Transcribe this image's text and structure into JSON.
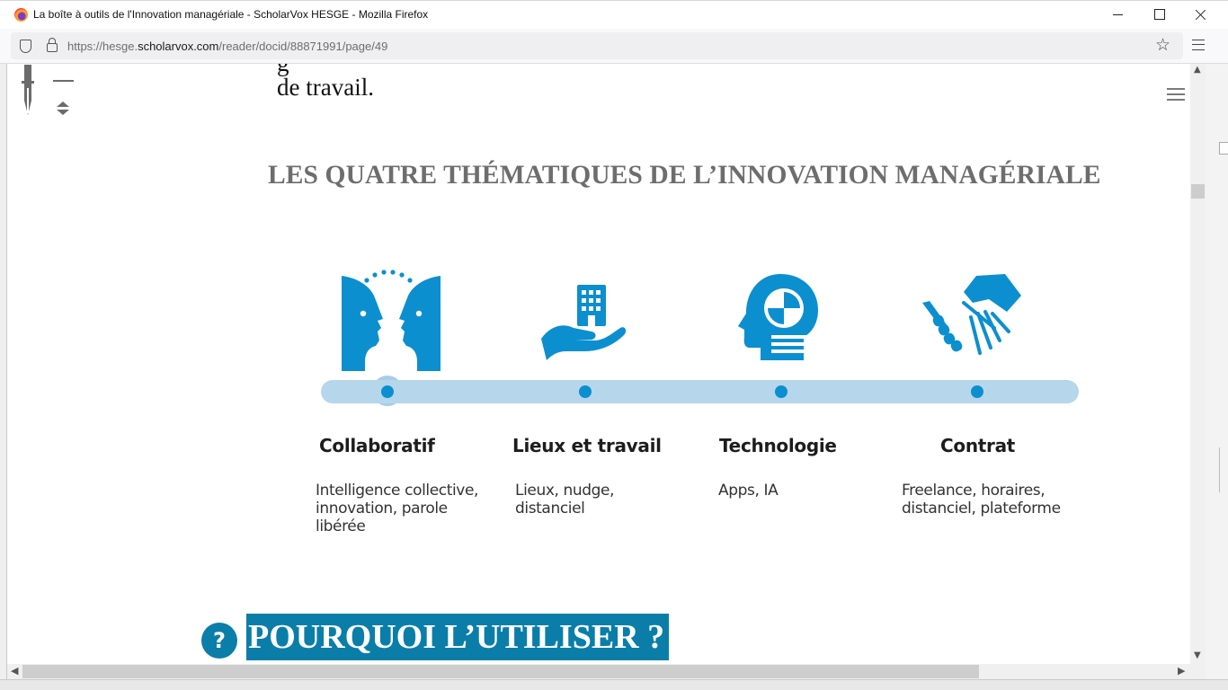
{
  "window": {
    "title": "La boîte à outils de l'Innovation managériale - ScholarVox HESGE - Mozilla Firefox"
  },
  "browser": {
    "url_prefix": "https://hesge.",
    "url_host": "scholarvox.com",
    "url_path": "/reader/docid/88871991/page/49",
    "icons": [
      "firefox-logo",
      "shield-icon",
      "lock-icon",
      "star-icon",
      "menu-icon"
    ]
  },
  "reader": {
    "icons": [
      "pen-icon",
      "zoom-out-icon",
      "reorder-icon",
      "list-icon"
    ]
  },
  "page": {
    "prev_fragment": "g",
    "prev_text": "de travail.",
    "section_title": "LES QUATRE THÉMATIQUES DE L’INNOVATION MANAGÉRIALE",
    "accent_color": "#0c8fcf",
    "timeline_color": "#b6d6ec",
    "themes": [
      {
        "icon": "faces-icon",
        "title": "Collaboratif",
        "desc": [
          "Intelligence collective,",
          "innovation, parole",
          "libérée"
        ]
      },
      {
        "icon": "building-hand-icon",
        "title": "Lieux et travail",
        "desc": [
          "Lieux, nudge,",
          "distanciel"
        ]
      },
      {
        "icon": "ai-head-icon",
        "title": "Technologie",
        "desc": [
          "Apps, IA"
        ]
      },
      {
        "icon": "handshake-icon",
        "title": "Contrat",
        "desc": [
          "Freelance, horaires,",
          "distanciel, plateforme"
        ]
      }
    ],
    "subheading": "POURQUOI L’UTILISER ?",
    "help_glyph": "?",
    "subheading_color": "#0a7ea8"
  }
}
